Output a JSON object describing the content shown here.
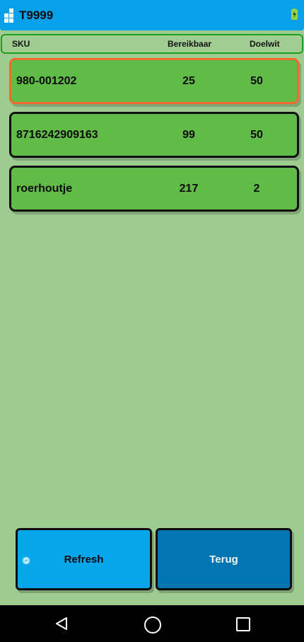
{
  "app": {
    "title": "T9999"
  },
  "table": {
    "headers": {
      "sku": "SKU",
      "available": "Bereikbaar",
      "target": "Doelwit"
    },
    "rows": [
      {
        "sku": "980-001202",
        "available": "25",
        "target": "50",
        "selected": true
      },
      {
        "sku": "8716242909163",
        "available": "99",
        "target": "50",
        "selected": false
      },
      {
        "sku": "roerhoutje",
        "available": "217",
        "target": "2",
        "selected": false
      }
    ]
  },
  "buttons": {
    "refresh": "Refresh",
    "back": "Terug"
  },
  "colors": {
    "background": "#9ecb8f",
    "row": "#61bb48",
    "selected_border": "#f06a2c",
    "refresh_button": "#07a6eb",
    "back_button": "#0274b2",
    "status_bar": "#08a1e9"
  },
  "icons": {
    "app": "app-logo-icon",
    "battery": "battery-charging-icon",
    "refresh": "refresh-icon",
    "nav": [
      "back-triangle-icon",
      "home-circle-icon",
      "recent-apps-square-icon"
    ]
  }
}
